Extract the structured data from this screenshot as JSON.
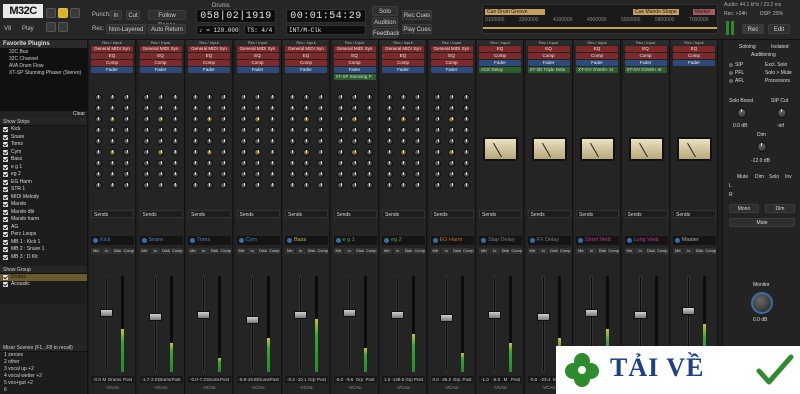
{
  "topbar": {
    "logo": "M32C",
    "buttons": {
      "v8": "V8",
      "play": "Play"
    },
    "punch_label": "Punch:",
    "punch_in": "In",
    "punch_out": "Cut",
    "follow_range": "Follow Range",
    "rec_label": "Rec:",
    "rec_mode": "Non-Layered",
    "auto_return": "Auto Return",
    "drums_label": "Drums",
    "bbt_clock": "058|02|1919",
    "time_clock": "00:01:54:29",
    "tempo": "♪ = 120.000",
    "ts": "TS: 4/4",
    "sync": "INT/M-Clk",
    "solo": "Solo",
    "audition": "Audition",
    "feedback": "Feedback",
    "rec_cues": "Rec Cues",
    "play_cues": "Play Cues",
    "cue_left": "Cue Drum Groove",
    "cue_right": "Cue Mando Shape",
    "cue_far": "Marker",
    "ruler_ticks": [
      "3100000",
      "3300000",
      "4100000",
      "4900000",
      "5500000",
      "5800000",
      "7000000"
    ],
    "audio_info": "Audio: 44.1 kHz / 23.2 ms",
    "rec_info": "Rec: >24h",
    "dsp": "DSP: 25%",
    "mode_buttons": [
      "Rec",
      "Edit"
    ]
  },
  "sidebar": {
    "plugins_title": "Favorite Plugins",
    "plugins": [
      "32C Bus",
      "32C Channel",
      "AVA Drum Flow",
      "XT-SP Stunning Phaser (Stereo)"
    ],
    "clear_label": "Clear",
    "strips_head": "Show  Strips",
    "strips": [
      "Kick",
      "Snare",
      "Toms",
      "Cym",
      "Bass",
      "e g 1",
      "eg 2",
      "EG Harm",
      "STR 1",
      "MIDI Melody",
      "Mando",
      "Mando dbl",
      "Mando harm",
      "AG",
      "Perc Loops",
      "MB 1 : Kick 1",
      "MB 2 : Snare 1",
      "MB 3 : D Kit"
    ],
    "groups_head": "Show  Group",
    "groups": [
      "Drums",
      "Acoustic"
    ],
    "scenes_title": "Mixer Scenes (F1...F8 to recall)",
    "scenes": [
      "1 zeroes",
      "2 other",
      "3 vocal up +2",
      "4 vocal wetter +2",
      "5 vox+gut +2",
      "6"
    ]
  },
  "strips": [
    {
      "name": "Kick",
      "color": "#4a7fc4",
      "gain": "-0.0",
      "pan": "M",
      "group": "Drums",
      "post": "Post",
      "fader_level": 0.62,
      "meter": 0.45
    },
    {
      "name": "Snare",
      "color": "#4a7fc4",
      "gain": "-1.7",
      "pan": "-2.0",
      "group": "Drums",
      "post": "Post",
      "fader_level": 0.58,
      "meter": 0.3
    },
    {
      "name": "Toms",
      "color": "#4a7fc4",
      "gain": "-0.0",
      "pan": "-7.2",
      "group": "Drums",
      "post": "Post",
      "fader_level": 0.6,
      "meter": 0.15
    },
    {
      "name": "Cym",
      "color": "#4a7fc4",
      "gain": "-6.9",
      "pan": "-19.8",
      "group": "Drums",
      "post": "Post",
      "fader_level": 0.55,
      "meter": 0.35
    },
    {
      "name": "Bass",
      "color": "#c6b24a",
      "gain": "-0.3",
      "pan": "-10.1",
      "group": "Grp",
      "post": "Post",
      "fader_level": 0.6,
      "meter": 0.55
    },
    {
      "name": "e g 1",
      "color": "#5aa64a",
      "gain": "-6.0",
      "pan": "-9.6",
      "group": "Grp",
      "post": "Post",
      "fader_level": 0.63,
      "meter": 0.25
    },
    {
      "name": "eg 2",
      "color": "#5aa64a",
      "gain": "1.0",
      "pan": "-149.5",
      "group": "Grp",
      "post": "Post",
      "fader_level": 0.6,
      "meter": 0.4
    },
    {
      "name": "EG Harm",
      "color": "#c06a2a",
      "gain": "0.0",
      "pan": "-36.2",
      "group": "Grp",
      "post": "Post",
      "fader_level": 0.57,
      "meter": 0.2
    },
    {
      "name": "Slap Delay",
      "color": "#7a7a7a",
      "gain": "-1.0",
      "pan": "-6.0",
      "group": "M",
      "post": "Post",
      "fader_level": 0.6,
      "meter": 0.3
    },
    {
      "name": "FX Delay",
      "color": "#7a7a7a",
      "gain": "-0.0",
      "pan": "-23.4",
      "group": "M",
      "post": "Post",
      "fader_level": 0.58,
      "meter": 0.35
    },
    {
      "name": "Short Verb",
      "color": "#c43a8a",
      "gain": "-0.0",
      "pan": "-22.0",
      "group": "M",
      "post": "Post",
      "fader_level": 0.62,
      "meter": 0.45
    },
    {
      "name": "Long Verb",
      "color": "#c43a8a",
      "gain": "-0.0",
      "pan": "-0.9",
      "group": "M",
      "post": "Post",
      "fader_level": 0.6,
      "meter": 0.25
    },
    {
      "name": "Master",
      "color": "#aaaaaa",
      "gain": "0.0",
      "pan": "-4.5",
      "group": "Monitor",
      "post": "Post",
      "fader_level": 0.65,
      "meter": 0.5
    }
  ],
  "route_label": "Rec / Input",
  "plugin_eq": "EQ",
  "plugin_comp": "Comp",
  "plugin_fader": "Fader",
  "plugin_general": "General MIDI Syn",
  "plugin_phaser": "XT-SP Stunning P",
  "bus_inserts": [
    "ACE Delay",
    "XT-3D Triple Dela",
    "XT-GV GVerb+ st",
    "XT-GV GVerb+ st"
  ],
  "sends_label": "Sends",
  "vca_label": "-VCAs-",
  "mini_btns": [
    "Mtr",
    "In",
    "Disk",
    "Comp"
  ],
  "right_panel": {
    "soloing": "Soloing",
    "isolated": "Isolated",
    "auditioning": "Auditioning",
    "sip": "SIP",
    "excl_solo": "Excl. Solo",
    "pfl": "PFL",
    "solo_mute": "Solo > Mute",
    "afl": "AFL",
    "processors": "Processors",
    "solo_boost": "Solo Boost",
    "sip_cut": "SIP Cut",
    "solo_boost_value": "0.0 dB",
    "sip_cut_value": "-inf",
    "dim_label": "Dim",
    "dim_value": "-12.0 dB",
    "dim_row": [
      "Mute",
      "Dim",
      "Solo",
      "Inv"
    ],
    "ch_l": "L",
    "ch_r": "R",
    "mono": "Mono",
    "dim_btn": "Dim",
    "mute": "Mute",
    "monitor": "Monitor",
    "monitor_value": "0.0 dB"
  },
  "watermark": {
    "text": "TẢI VỀ"
  }
}
